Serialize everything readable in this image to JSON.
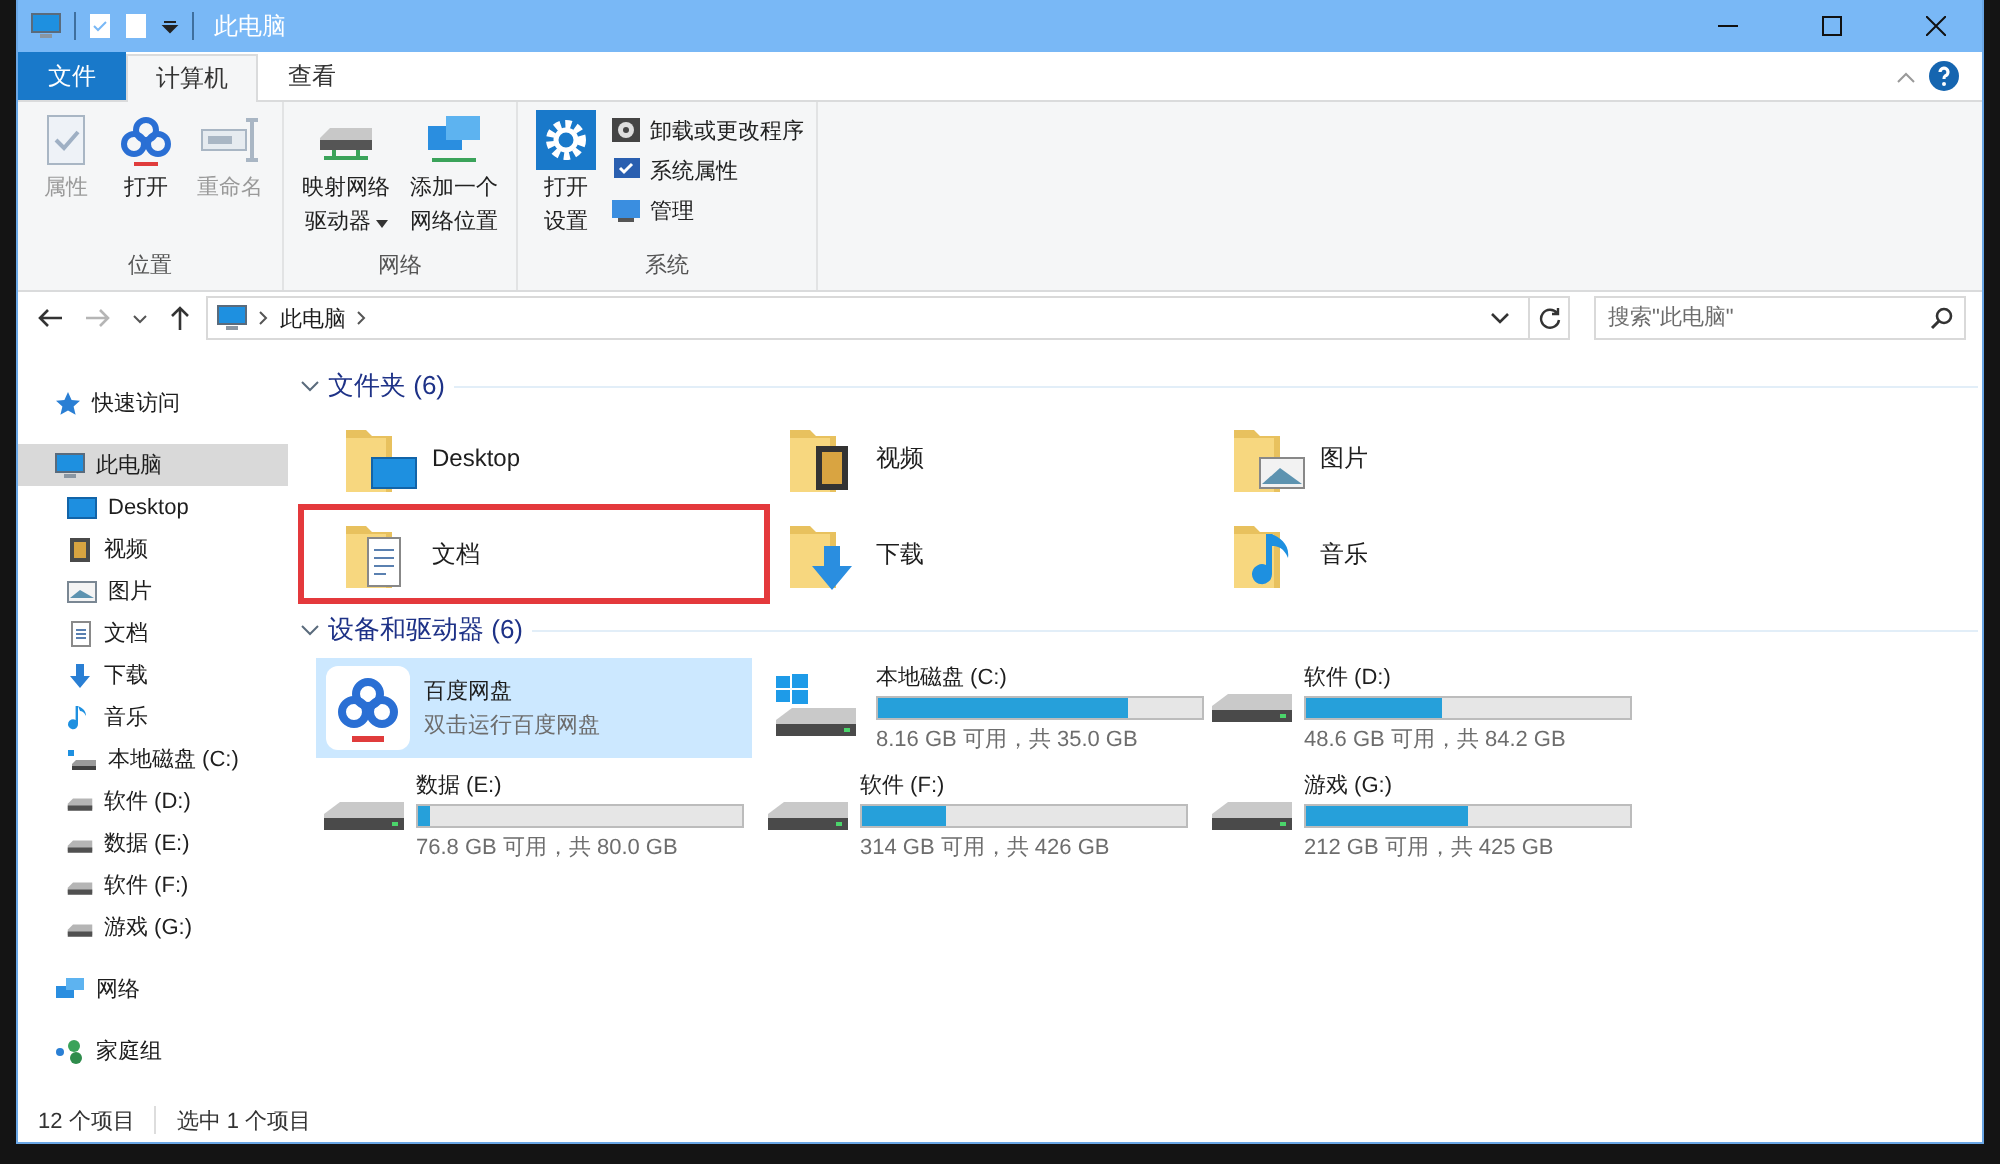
{
  "window": {
    "title": "此电脑"
  },
  "ribbon": {
    "tabs": [
      {
        "label": "文件",
        "kind": "file",
        "selected": false
      },
      {
        "label": "计算机",
        "kind": "tab",
        "selected": true
      },
      {
        "label": "查看",
        "kind": "tab",
        "selected": false
      }
    ],
    "groups": [
      {
        "label": "位置",
        "buttons": [
          {
            "kind": "properties",
            "lines": [
              "属性"
            ],
            "disabled": true,
            "dropdown": false
          },
          {
            "kind": "cloud",
            "lines": [
              "打开"
            ],
            "disabled": false,
            "dropdown": false
          },
          {
            "kind": "rename",
            "lines": [
              "重命名"
            ],
            "disabled": true,
            "dropdown": false
          }
        ]
      },
      {
        "label": "网络",
        "buttons": [
          {
            "kind": "map-drive",
            "lines": [
              "映射网络",
              "驱动器"
            ],
            "disabled": false,
            "dropdown": true
          },
          {
            "kind": "add-location",
            "lines": [
              "添加一个",
              "网络位置"
            ],
            "disabled": false,
            "dropdown": false
          }
        ]
      },
      {
        "label": "系统",
        "buttons": [
          {
            "kind": "settings",
            "lines": [
              "打开",
              "设置"
            ],
            "disabled": false,
            "dropdown": false
          }
        ],
        "commands": [
          {
            "kind": "uninstall",
            "label": "卸载或更改程序"
          },
          {
            "kind": "system-properties",
            "label": "系统属性"
          },
          {
            "kind": "manage",
            "label": "管理"
          }
        ]
      }
    ]
  },
  "address": {
    "path": [
      "此电脑"
    ],
    "search": {
      "placeholder": "搜索\"此电脑\""
    }
  },
  "sidebar": {
    "items": [
      {
        "kind": "quick-access",
        "label": "快速访问",
        "selected": false
      },
      {
        "kind": "pc",
        "label": "此电脑",
        "selected": true,
        "children": [
          {
            "kind": "desktop",
            "label": "Desktop",
            "selected": false
          },
          {
            "kind": "video",
            "label": "视频",
            "selected": false
          },
          {
            "kind": "pictures",
            "label": "图片",
            "selected": false
          },
          {
            "kind": "documents",
            "label": "文档",
            "selected": false
          },
          {
            "kind": "downloads",
            "label": "下载",
            "selected": false
          },
          {
            "kind": "music",
            "label": "音乐",
            "selected": false
          },
          {
            "kind": "system-drive",
            "label": "本地磁盘 (C:)",
            "selected": false
          },
          {
            "kind": "drive",
            "label": "软件 (D:)",
            "selected": false
          },
          {
            "kind": "drive",
            "label": "数据 (E:)",
            "selected": false
          },
          {
            "kind": "drive",
            "label": "软件 (F:)",
            "selected": false
          },
          {
            "kind": "drive",
            "label": "游戏 (G:)",
            "selected": false
          }
        ]
      },
      {
        "kind": "network",
        "label": "网络",
        "selected": false
      },
      {
        "kind": "homegroup",
        "label": "家庭组",
        "selected": false
      }
    ]
  },
  "folders": {
    "title": "文件夹 (6)",
    "expanded": true,
    "items": [
      {
        "kind": "desktop",
        "label": "Desktop",
        "marked": false
      },
      {
        "kind": "video",
        "label": "视频",
        "marked": false
      },
      {
        "kind": "pictures",
        "label": "图片",
        "marked": false
      },
      {
        "kind": "documents",
        "label": "文档",
        "marked": true
      },
      {
        "kind": "downloads",
        "label": "下载",
        "marked": false
      },
      {
        "kind": "music",
        "label": "音乐",
        "marked": false
      }
    ]
  },
  "devices": {
    "title": "设备和驱动器 (6)",
    "expanded": true,
    "items": [
      {
        "kind": "app",
        "name": "百度网盘",
        "subtitle": "双击运行百度网盘",
        "selected": true
      },
      {
        "kind": "system-drive",
        "name": "本地磁盘 (C:)",
        "level": 0.77,
        "reading": "8.16 GB 可用，共 35.0 GB",
        "selected": false
      },
      {
        "kind": "drive",
        "name": "软件 (D:)",
        "level": 0.42,
        "reading": "48.6 GB 可用，共 84.2 GB",
        "selected": false
      },
      {
        "kind": "drive",
        "name": "数据 (E:)",
        "level": 0.04,
        "reading": "76.8 GB 可用，共 80.0 GB",
        "selected": false
      },
      {
        "kind": "drive",
        "name": "软件 (F:)",
        "level": 0.26,
        "reading": "314 GB 可用，共 426 GB",
        "selected": false
      },
      {
        "kind": "drive",
        "name": "游戏 (G:)",
        "level": 0.5,
        "reading": "212 GB 可用，共 425 GB",
        "selected": false
      }
    ]
  },
  "status_bar": {
    "item_count": "12 个项目",
    "selection": "选中 1 个项目"
  }
}
